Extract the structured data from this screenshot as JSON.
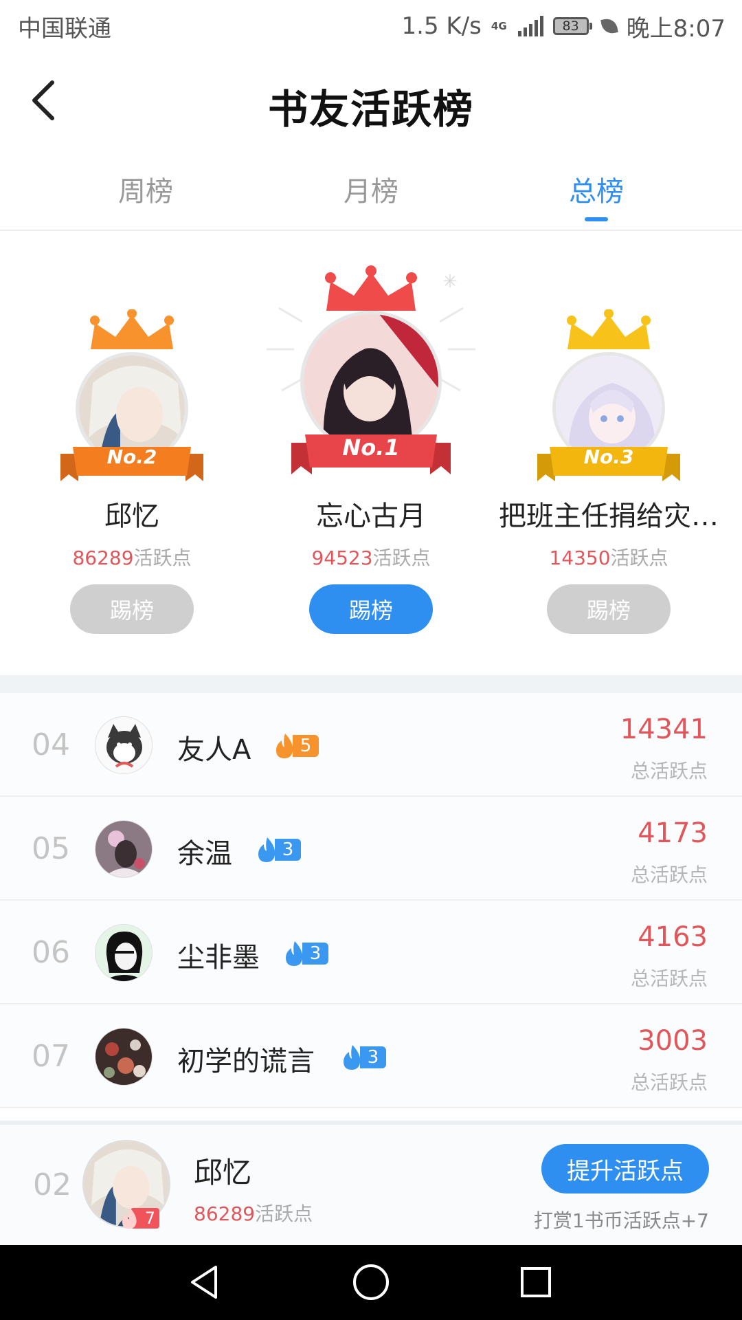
{
  "status_bar": {
    "carrier": "中国联通",
    "speed": "1.5 K/s",
    "network": "4G",
    "battery": "83",
    "time": "晚上8:07"
  },
  "header": {
    "title": "书友活跃榜",
    "back_icon": "chevron-left-icon"
  },
  "tabs": [
    {
      "label": "周榜",
      "active": false
    },
    {
      "label": "月榜",
      "active": false
    },
    {
      "label": "总榜",
      "active": true
    }
  ],
  "podium": [
    {
      "rank_label": "No.2",
      "name": "邱忆",
      "score": "86289",
      "unit": "活跃点",
      "button": "踢榜",
      "crown_color": "#f7922d",
      "ribbon_color": "#f47e1f"
    },
    {
      "rank_label": "No.1",
      "name": "忘心古月",
      "score": "94523",
      "unit": "活跃点",
      "button": "踢榜",
      "crown_color": "#ef4b4b",
      "ribbon_color": "#e8454a"
    },
    {
      "rank_label": "No.3",
      "name": "把班主任捐给灾…",
      "score": "14350",
      "unit": "活跃点",
      "button": "踢榜",
      "crown_color": "#f7c31a",
      "ribbon_color": "#f2b60f"
    }
  ],
  "list": [
    {
      "rank": "04",
      "name": "友人A",
      "level": "5",
      "badge_color": "#f7932c",
      "score": "14341",
      "score_label": "总活跃点"
    },
    {
      "rank": "05",
      "name": "余温",
      "level": "3",
      "badge_color": "#3b98f0",
      "score": "4173",
      "score_label": "总活跃点"
    },
    {
      "rank": "06",
      "name": "尘非墨",
      "level": "3",
      "badge_color": "#3b98f0",
      "score": "4163",
      "score_label": "总活跃点"
    },
    {
      "rank": "07",
      "name": "初学的谎言",
      "level": "3",
      "badge_color": "#3b98f0",
      "score": "3003",
      "score_label": "总活跃点"
    }
  ],
  "me": {
    "rank": "02",
    "name": "邱忆",
    "level": "7",
    "score": "86289",
    "unit": "活跃点",
    "button": "提升活跃点",
    "tip": "打赏1书币活跃点+7"
  },
  "colors": {
    "accent": "#2e8ff0",
    "score_red": "#e0575b"
  },
  "nav": [
    "back-triangle-icon",
    "home-circle-icon",
    "recents-square-icon"
  ]
}
